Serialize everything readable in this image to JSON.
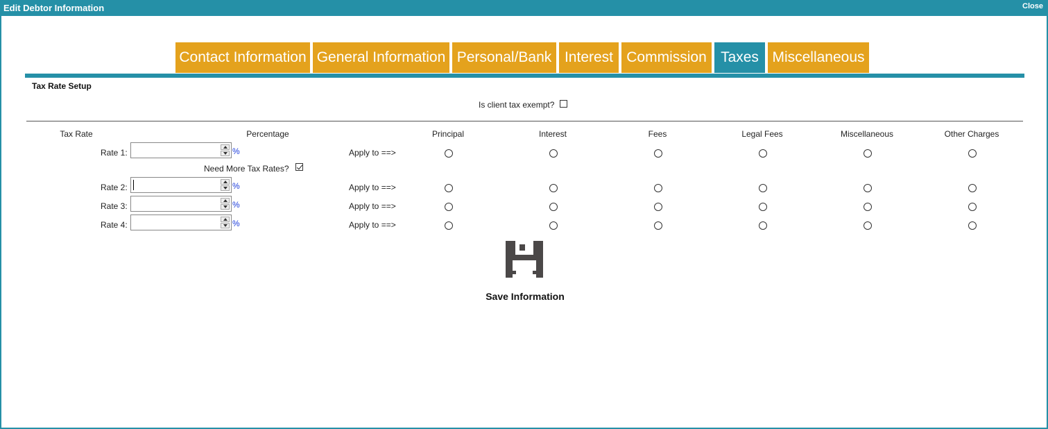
{
  "window": {
    "title": "Edit Debtor Information",
    "close_label": "Close"
  },
  "tabs": [
    {
      "label": "Contact Information",
      "active": false
    },
    {
      "label": "General Information",
      "active": false
    },
    {
      "label": "Personal/Bank",
      "active": false
    },
    {
      "label": "Interest",
      "active": false
    },
    {
      "label": "Commission",
      "active": false
    },
    {
      "label": "Taxes",
      "active": true
    },
    {
      "label": "Miscellaneous",
      "active": false
    }
  ],
  "colors": {
    "accent": "#2590a7",
    "tab": "#e4a21d"
  },
  "tax": {
    "section_title": "Tax Rate Setup",
    "exempt_label": "Is client tax exempt?",
    "exempt_checked": false,
    "need_more_label": "Need More Tax Rates?",
    "need_more_checked": true,
    "headers": {
      "tax_rate": "Tax Rate",
      "percentage": "Percentage",
      "principal": "Principal",
      "interest": "Interest",
      "fees": "Fees",
      "legal_fees": "Legal Fees",
      "miscellaneous": "Miscellaneous",
      "other_charges": "Other Charges"
    },
    "rows": [
      {
        "label": "Rate 1:",
        "value": "",
        "unit": "%",
        "apply_label": "Apply to ==>"
      },
      {
        "label": "Rate 2:",
        "value": "",
        "unit": "%",
        "apply_label": "Apply to ==>"
      },
      {
        "label": "Rate 3:",
        "value": "",
        "unit": "%",
        "apply_label": "Apply to ==>"
      },
      {
        "label": "Rate 4:",
        "value": "",
        "unit": "%",
        "apply_label": "Apply to ==>"
      }
    ]
  },
  "save": {
    "label": "Save Information",
    "icon": "save-icon"
  }
}
